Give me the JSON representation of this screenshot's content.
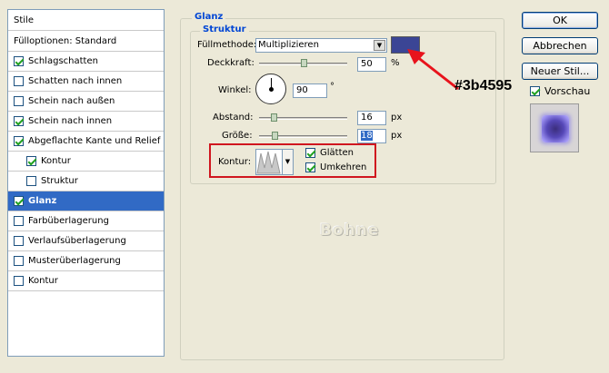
{
  "style_list": {
    "header": "Stile",
    "blend_options": "Fülloptionen: Standard",
    "items": [
      {
        "label": "Schlagschatten",
        "checked": true
      },
      {
        "label": "Schatten nach innen",
        "checked": false
      },
      {
        "label": "Schein nach außen",
        "checked": false
      },
      {
        "label": "Schein nach innen",
        "checked": true
      },
      {
        "label": "Abgeflachte Kante und Relief",
        "checked": true
      },
      {
        "label": "Kontur",
        "checked": true
      },
      {
        "label": "Struktur",
        "checked": false
      },
      {
        "label": "Glanz",
        "checked": true,
        "selected": true
      },
      {
        "label": "Farbüberlagerung",
        "checked": false
      },
      {
        "label": "Verlaufsüberlagerung",
        "checked": false
      },
      {
        "label": "Musterüberlagerung",
        "checked": false
      },
      {
        "label": "Kontur",
        "checked": false
      }
    ]
  },
  "panel": {
    "group_title": "Glanz",
    "subgroup_title": "Struktur",
    "blend_mode_label": "Füllmethode:",
    "blend_mode_value": "Multiplizieren",
    "blend_color": "#3b4595",
    "opacity_label": "Deckkraft:",
    "opacity_value": "50",
    "opacity_unit": "%",
    "angle_label": "Winkel:",
    "angle_value": "90",
    "angle_unit": "°",
    "distance_label": "Abstand:",
    "distance_value": "16",
    "distance_unit": "px",
    "size_label": "Größe:",
    "size_value": "18",
    "size_unit": "px",
    "contour_label": "Kontur:",
    "smooth_label": "Glätten",
    "invert_label": "Umkehren",
    "opacity_level": 0.5,
    "distance_level": 0.16,
    "size_level": 0.18
  },
  "buttons": {
    "ok": "OK",
    "cancel": "Abbrechen",
    "new_style": "Neuer Stil...",
    "preview_label": "Vorschau"
  },
  "annotation": {
    "color_label": "#3b4595"
  },
  "watermark": "Bohne"
}
